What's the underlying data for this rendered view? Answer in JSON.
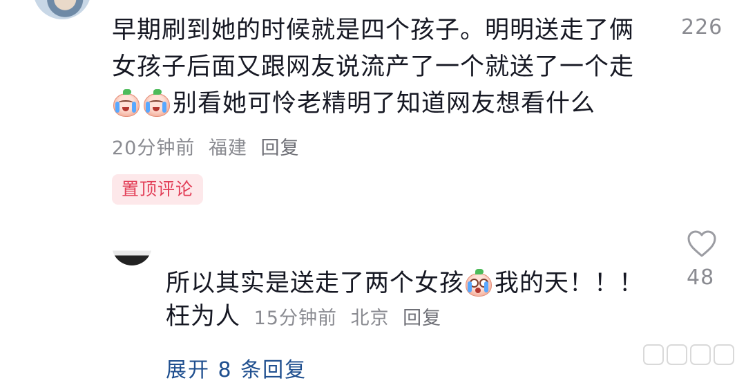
{
  "comment": {
    "text_line1": "早期刷到她的时候就是四个孩子。明明送走了俩",
    "text_line2": "女孩子后面又跟网友说流产了一个就送了一个走",
    "text_line3": "别看她可怜老精明了知道网友想看什么",
    "emoji_icons": [
      "crying-peach-icon",
      "crying-peach-icon"
    ],
    "time": "20分钟前",
    "location": "福建",
    "reply_label": "回复",
    "badge": "置顶评论",
    "like_count": "226"
  },
  "reply": {
    "text_part1": "所以其实是送走了两个女孩",
    "emoji_icon": "surprised-peach-icon",
    "text_part2": "我的天！！！",
    "text_part3": "枉为人",
    "time": "15分钟前",
    "location": "北京",
    "reply_label": "回复",
    "like_count": "48"
  },
  "expand_label": "展开 8 条回复",
  "colors": {
    "text": "#161823",
    "meta": "#8a8b91",
    "badge_bg": "#fde8ea",
    "badge_text": "#e23e57",
    "link": "#1f4f8f"
  }
}
